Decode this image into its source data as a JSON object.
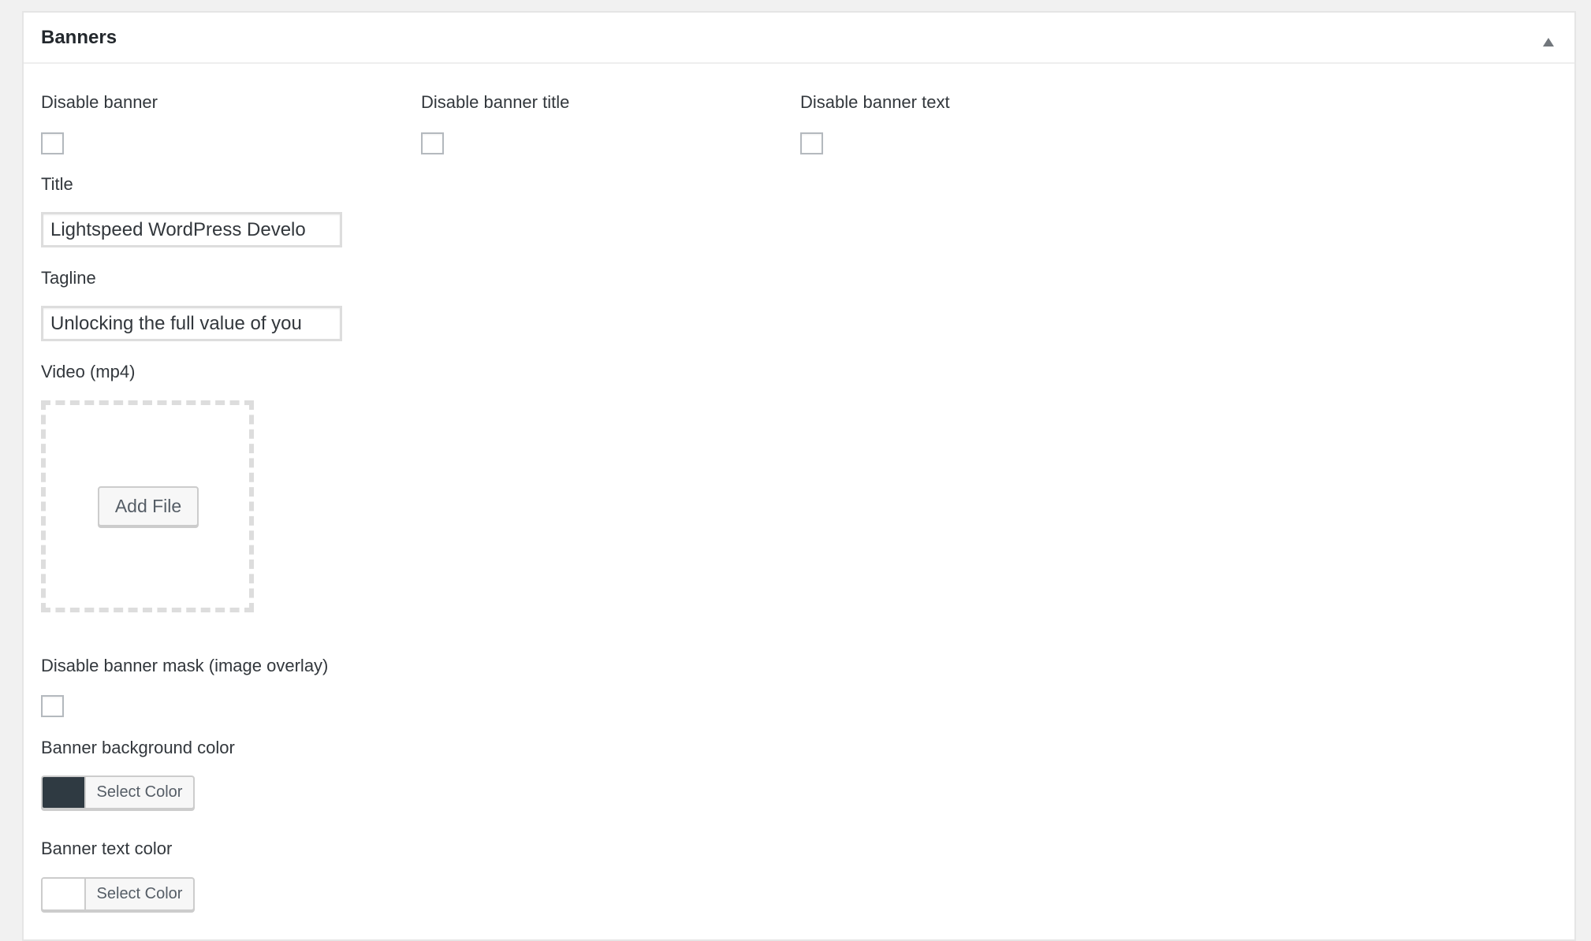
{
  "panel": {
    "title": "Banners",
    "toggle_icon": "triangle-up-icon"
  },
  "fields": {
    "disable_banner": {
      "label": "Disable banner",
      "checked": false
    },
    "disable_banner_title": {
      "label": "Disable banner title",
      "checked": false
    },
    "disable_banner_text": {
      "label": "Disable banner text",
      "checked": false
    },
    "title": {
      "label": "Title",
      "value": "Lightspeed WordPress Develo"
    },
    "tagline": {
      "label": "Tagline",
      "value": "Unlocking the full value of you"
    },
    "video": {
      "label": "Video (mp4)",
      "button_label": "Add File"
    },
    "disable_banner_mask": {
      "label": "Disable banner mask (image overlay)",
      "checked": false
    },
    "banner_bg_color": {
      "label": "Banner background color",
      "button_label": "Select Color",
      "color": "#2f3a42"
    },
    "banner_text_color": {
      "label": "Banner text color",
      "button_label": "Select Color",
      "color": "#ffffff"
    }
  }
}
